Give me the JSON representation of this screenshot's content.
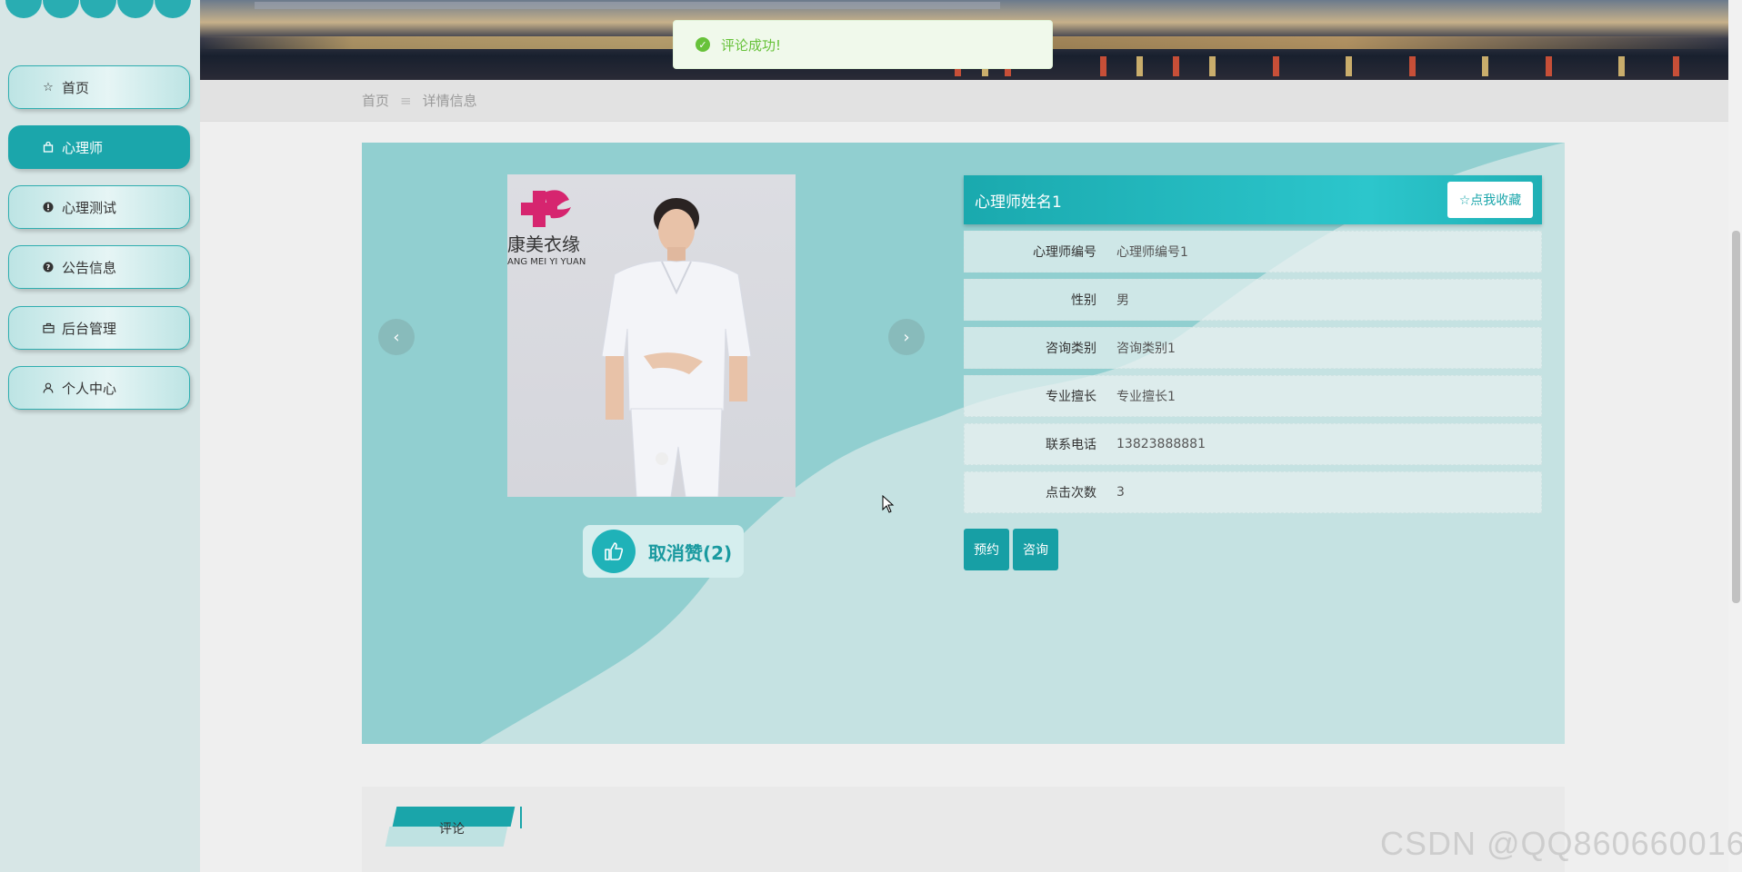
{
  "sidebar": {
    "items": [
      {
        "label": "首页",
        "icon": "star-icon",
        "active": false
      },
      {
        "label": "心理师",
        "icon": "bag-icon",
        "active": true
      },
      {
        "label": "心理测试",
        "icon": "alert-circle-icon",
        "active": false
      },
      {
        "label": "公告信息",
        "icon": "question-circle-icon",
        "active": false
      },
      {
        "label": "后台管理",
        "icon": "briefcase-icon",
        "active": false
      },
      {
        "label": "个人中心",
        "icon": "user-icon",
        "active": false
      }
    ]
  },
  "toast": {
    "message": "评论成功!",
    "icon": "success-check-icon"
  },
  "breadcrumb": {
    "home": "首页",
    "separator": "≡",
    "current": "详情信息"
  },
  "detail": {
    "like_label": "取消赞(2)",
    "photo_logo_text": "康美衣缘",
    "photo_logo_sub": "ANG MEI YI YUAN",
    "title": "心理师姓名1",
    "favorite_label": "☆点我收藏",
    "fields": [
      {
        "label": "心理师编号",
        "value": "心理师编号1"
      },
      {
        "label": "性别",
        "value": "男"
      },
      {
        "label": "咨询类别",
        "value": "咨询类别1"
      },
      {
        "label": "专业擅长",
        "value": "专业擅长1"
      },
      {
        "label": "联系电话",
        "value": "13823888881"
      },
      {
        "label": "点击次数",
        "value": "3"
      }
    ],
    "actions": {
      "book": "预约",
      "consult": "咨询"
    }
  },
  "comments": {
    "tab_label": "评论"
  },
  "watermark": "CSDN @QQ860660016",
  "colors": {
    "accent": "#1ba6ab",
    "card": "#91cfd0",
    "wave": "#c5e2e2",
    "toast_green": "#67c23a"
  }
}
